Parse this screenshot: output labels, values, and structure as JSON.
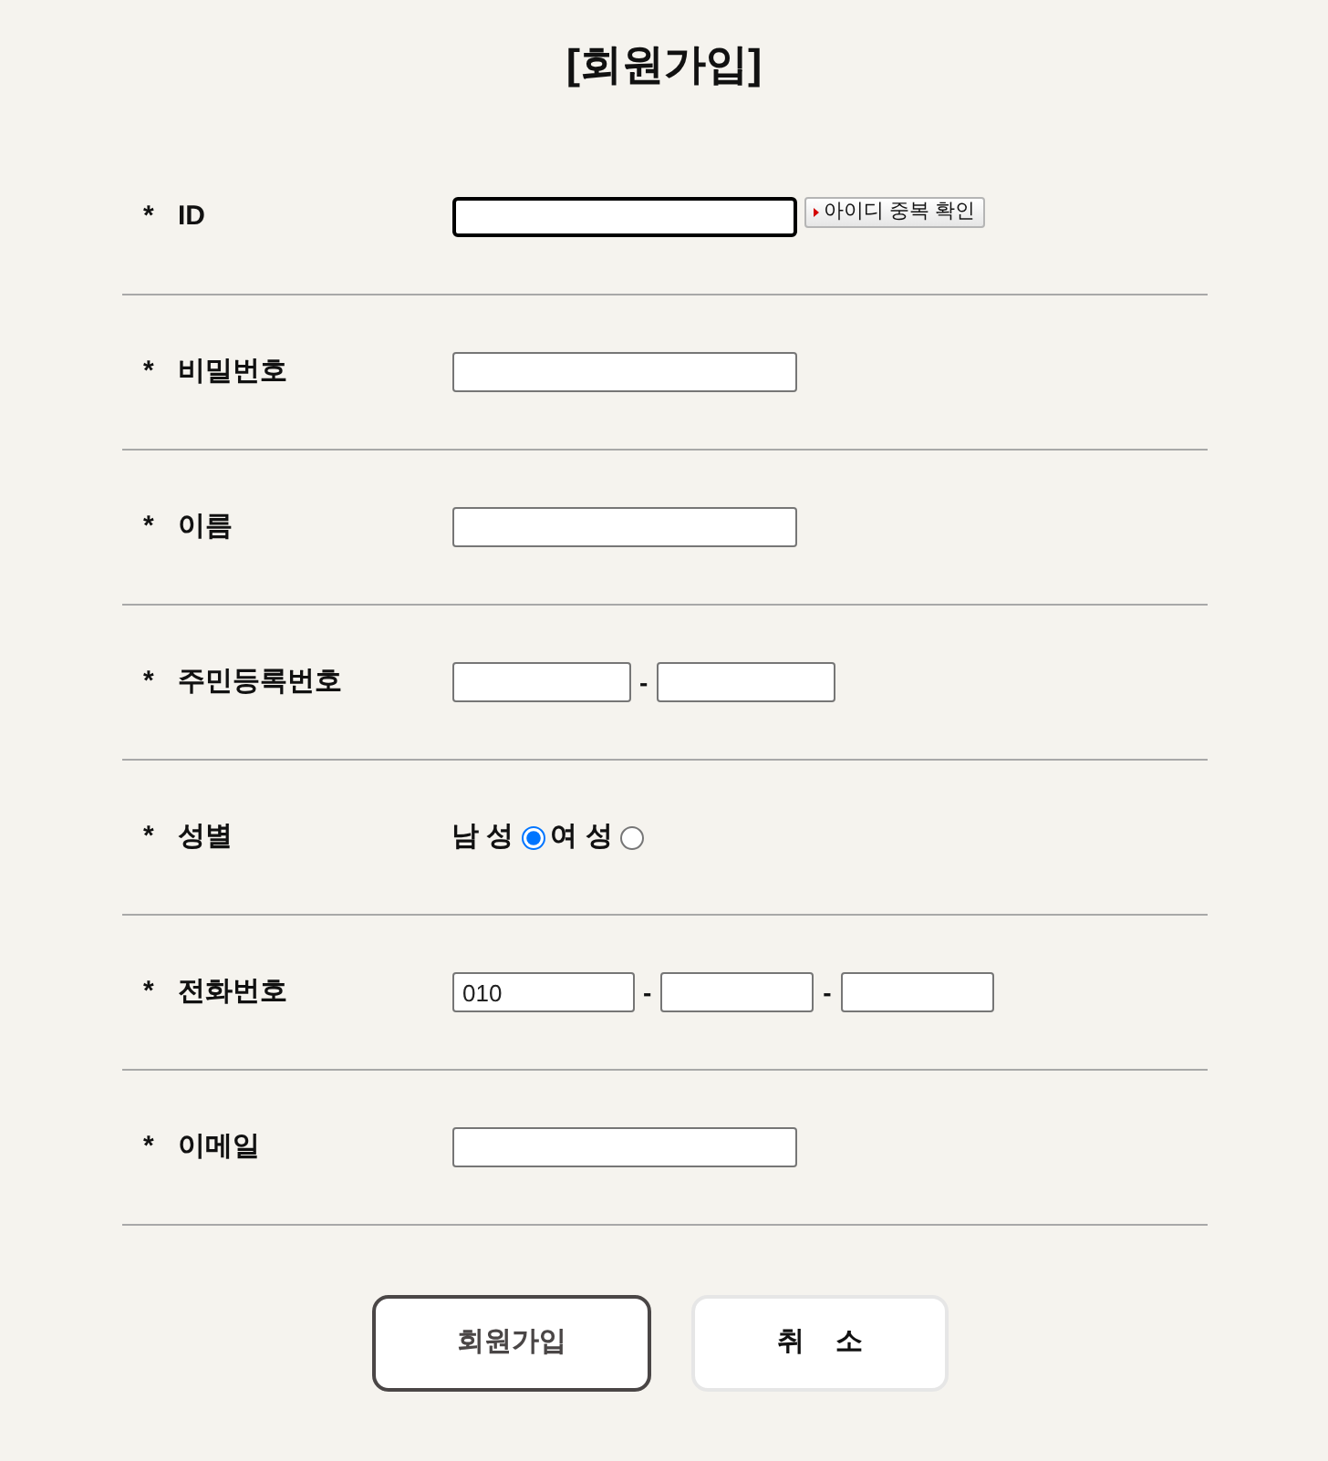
{
  "title": "[회원가입]",
  "fields": [
    {
      "kind": "text",
      "mark": "*",
      "label": "ID",
      "inputs": [
        {
          "focused": true
        }
      ],
      "button": "아이디 중복 확인"
    },
    {
      "kind": "text",
      "mark": "*",
      "label": "비밀번호",
      "inputs": [
        {
          "focused": false
        }
      ]
    },
    {
      "kind": "text",
      "mark": "*",
      "label": "이름",
      "inputs": [
        {
          "focused": false
        }
      ]
    },
    {
      "kind": "resident",
      "mark": "*",
      "label": "주민등록번호",
      "inputs": [
        {
          "focused": false
        },
        {
          "focused": false
        }
      ],
      "separators": [
        "-"
      ]
    },
    {
      "kind": "radio",
      "mark": "*",
      "label": "성별",
      "options": [
        {
          "label": "남 성",
          "selected": true
        },
        {
          "label": "여 성",
          "selected": false
        }
      ]
    },
    {
      "kind": "phone",
      "mark": "*",
      "label": "전화번호",
      "inputs": [
        {
          "value": "010",
          "focused": false
        },
        {
          "focused": false
        },
        {
          "focused": false
        }
      ],
      "separators": [
        "-",
        "-"
      ]
    },
    {
      "kind": "text",
      "mark": "*",
      "label": "이메일",
      "inputs": [
        {
          "focused": false
        }
      ]
    }
  ],
  "buttons": [
    {
      "kind": "primary",
      "label": "회원가입"
    },
    {
      "kind": "secondary",
      "label": "취    소"
    }
  ]
}
